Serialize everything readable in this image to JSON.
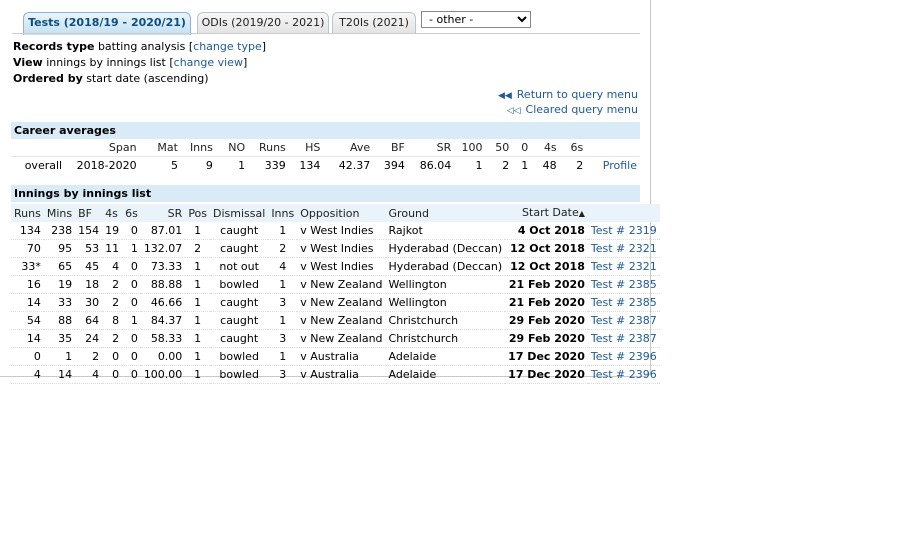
{
  "tabs": [
    {
      "label": "Tests (2018/19 - 2020/21)",
      "active": true
    },
    {
      "label": "ODIs (2019/20 - 2021)",
      "active": false
    },
    {
      "label": "T20Is (2021)",
      "active": false
    }
  ],
  "other_select": {
    "value": "- other -"
  },
  "info": {
    "records_type_label": "Records type",
    "records_type_value": "batting analysis",
    "records_type_link": "change type",
    "view_label": "View",
    "view_value": "innings by innings list",
    "view_link": "change view",
    "ordered_label": "Ordered by",
    "ordered_value": "start date (ascending)"
  },
  "query_links": {
    "return": "Return to query menu",
    "cleared": "Cleared query menu"
  },
  "career": {
    "title": "Career averages",
    "headers": [
      "Span",
      "Mat",
      "Inns",
      "NO",
      "Runs",
      "HS",
      "Ave",
      "BF",
      "SR",
      "100",
      "50",
      "0",
      "4s",
      "6s"
    ],
    "row": {
      "label": "overall",
      "values": [
        "2018-2020",
        "5",
        "9",
        "1",
        "339",
        "134",
        "42.37",
        "394",
        "86.04",
        "1",
        "2",
        "1",
        "48",
        "2"
      ],
      "link": "Profile"
    }
  },
  "innings": {
    "title": "Innings by innings list",
    "headers": [
      "Runs",
      "Mins",
      "BF",
      "4s",
      "6s",
      "SR",
      "Pos",
      "Dismissal",
      "Inns",
      "Opposition",
      "Ground",
      "Start Date"
    ],
    "rows": [
      {
        "runs": "134",
        "mins": "238",
        "bf": "154",
        "fours": "19",
        "sixes": "0",
        "sr": "87.01",
        "pos": "1",
        "dismissal": "caught",
        "inns": "1",
        "opp": "v West Indies",
        "ground": "Rajkot",
        "date": "4 Oct 2018",
        "match": "Test # 2319"
      },
      {
        "runs": "70",
        "mins": "95",
        "bf": "53",
        "fours": "11",
        "sixes": "1",
        "sr": "132.07",
        "pos": "2",
        "dismissal": "caught",
        "inns": "2",
        "opp": "v West Indies",
        "ground": "Hyderabad (Deccan)",
        "date": "12 Oct 2018",
        "match": "Test # 2321"
      },
      {
        "runs": "33*",
        "mins": "65",
        "bf": "45",
        "fours": "4",
        "sixes": "0",
        "sr": "73.33",
        "pos": "1",
        "dismissal": "not out",
        "inns": "4",
        "opp": "v West Indies",
        "ground": "Hyderabad (Deccan)",
        "date": "12 Oct 2018",
        "match": "Test # 2321"
      },
      {
        "runs": "16",
        "mins": "19",
        "bf": "18",
        "fours": "2",
        "sixes": "0",
        "sr": "88.88",
        "pos": "1",
        "dismissal": "bowled",
        "inns": "1",
        "opp": "v New Zealand",
        "ground": "Wellington",
        "date": "21 Feb 2020",
        "match": "Test # 2385"
      },
      {
        "runs": "14",
        "mins": "33",
        "bf": "30",
        "fours": "2",
        "sixes": "0",
        "sr": "46.66",
        "pos": "1",
        "dismissal": "caught",
        "inns": "3",
        "opp": "v New Zealand",
        "ground": "Wellington",
        "date": "21 Feb 2020",
        "match": "Test # 2385"
      },
      {
        "runs": "54",
        "mins": "88",
        "bf": "64",
        "fours": "8",
        "sixes": "1",
        "sr": "84.37",
        "pos": "1",
        "dismissal": "caught",
        "inns": "1",
        "opp": "v New Zealand",
        "ground": "Christchurch",
        "date": "29 Feb 2020",
        "match": "Test # 2387"
      },
      {
        "runs": "14",
        "mins": "35",
        "bf": "24",
        "fours": "2",
        "sixes": "0",
        "sr": "58.33",
        "pos": "1",
        "dismissal": "caught",
        "inns": "3",
        "opp": "v New Zealand",
        "ground": "Christchurch",
        "date": "29 Feb 2020",
        "match": "Test # 2387"
      },
      {
        "runs": "0",
        "mins": "1",
        "bf": "2",
        "fours": "0",
        "sixes": "0",
        "sr": "0.00",
        "pos": "1",
        "dismissal": "bowled",
        "inns": "1",
        "opp": "v Australia",
        "ground": "Adelaide",
        "date": "17 Dec 2020",
        "match": "Test # 2396"
      },
      {
        "runs": "4",
        "mins": "14",
        "bf": "4",
        "fours": "0",
        "sixes": "0",
        "sr": "100.00",
        "pos": "1",
        "dismissal": "bowled",
        "inns": "3",
        "opp": "v Australia",
        "ground": "Adelaide",
        "date": "17 Dec 2020",
        "match": "Test # 2396"
      }
    ]
  },
  "colors": {
    "accent_link": "#1e5a96",
    "section_bg": "#d8ebf7"
  }
}
